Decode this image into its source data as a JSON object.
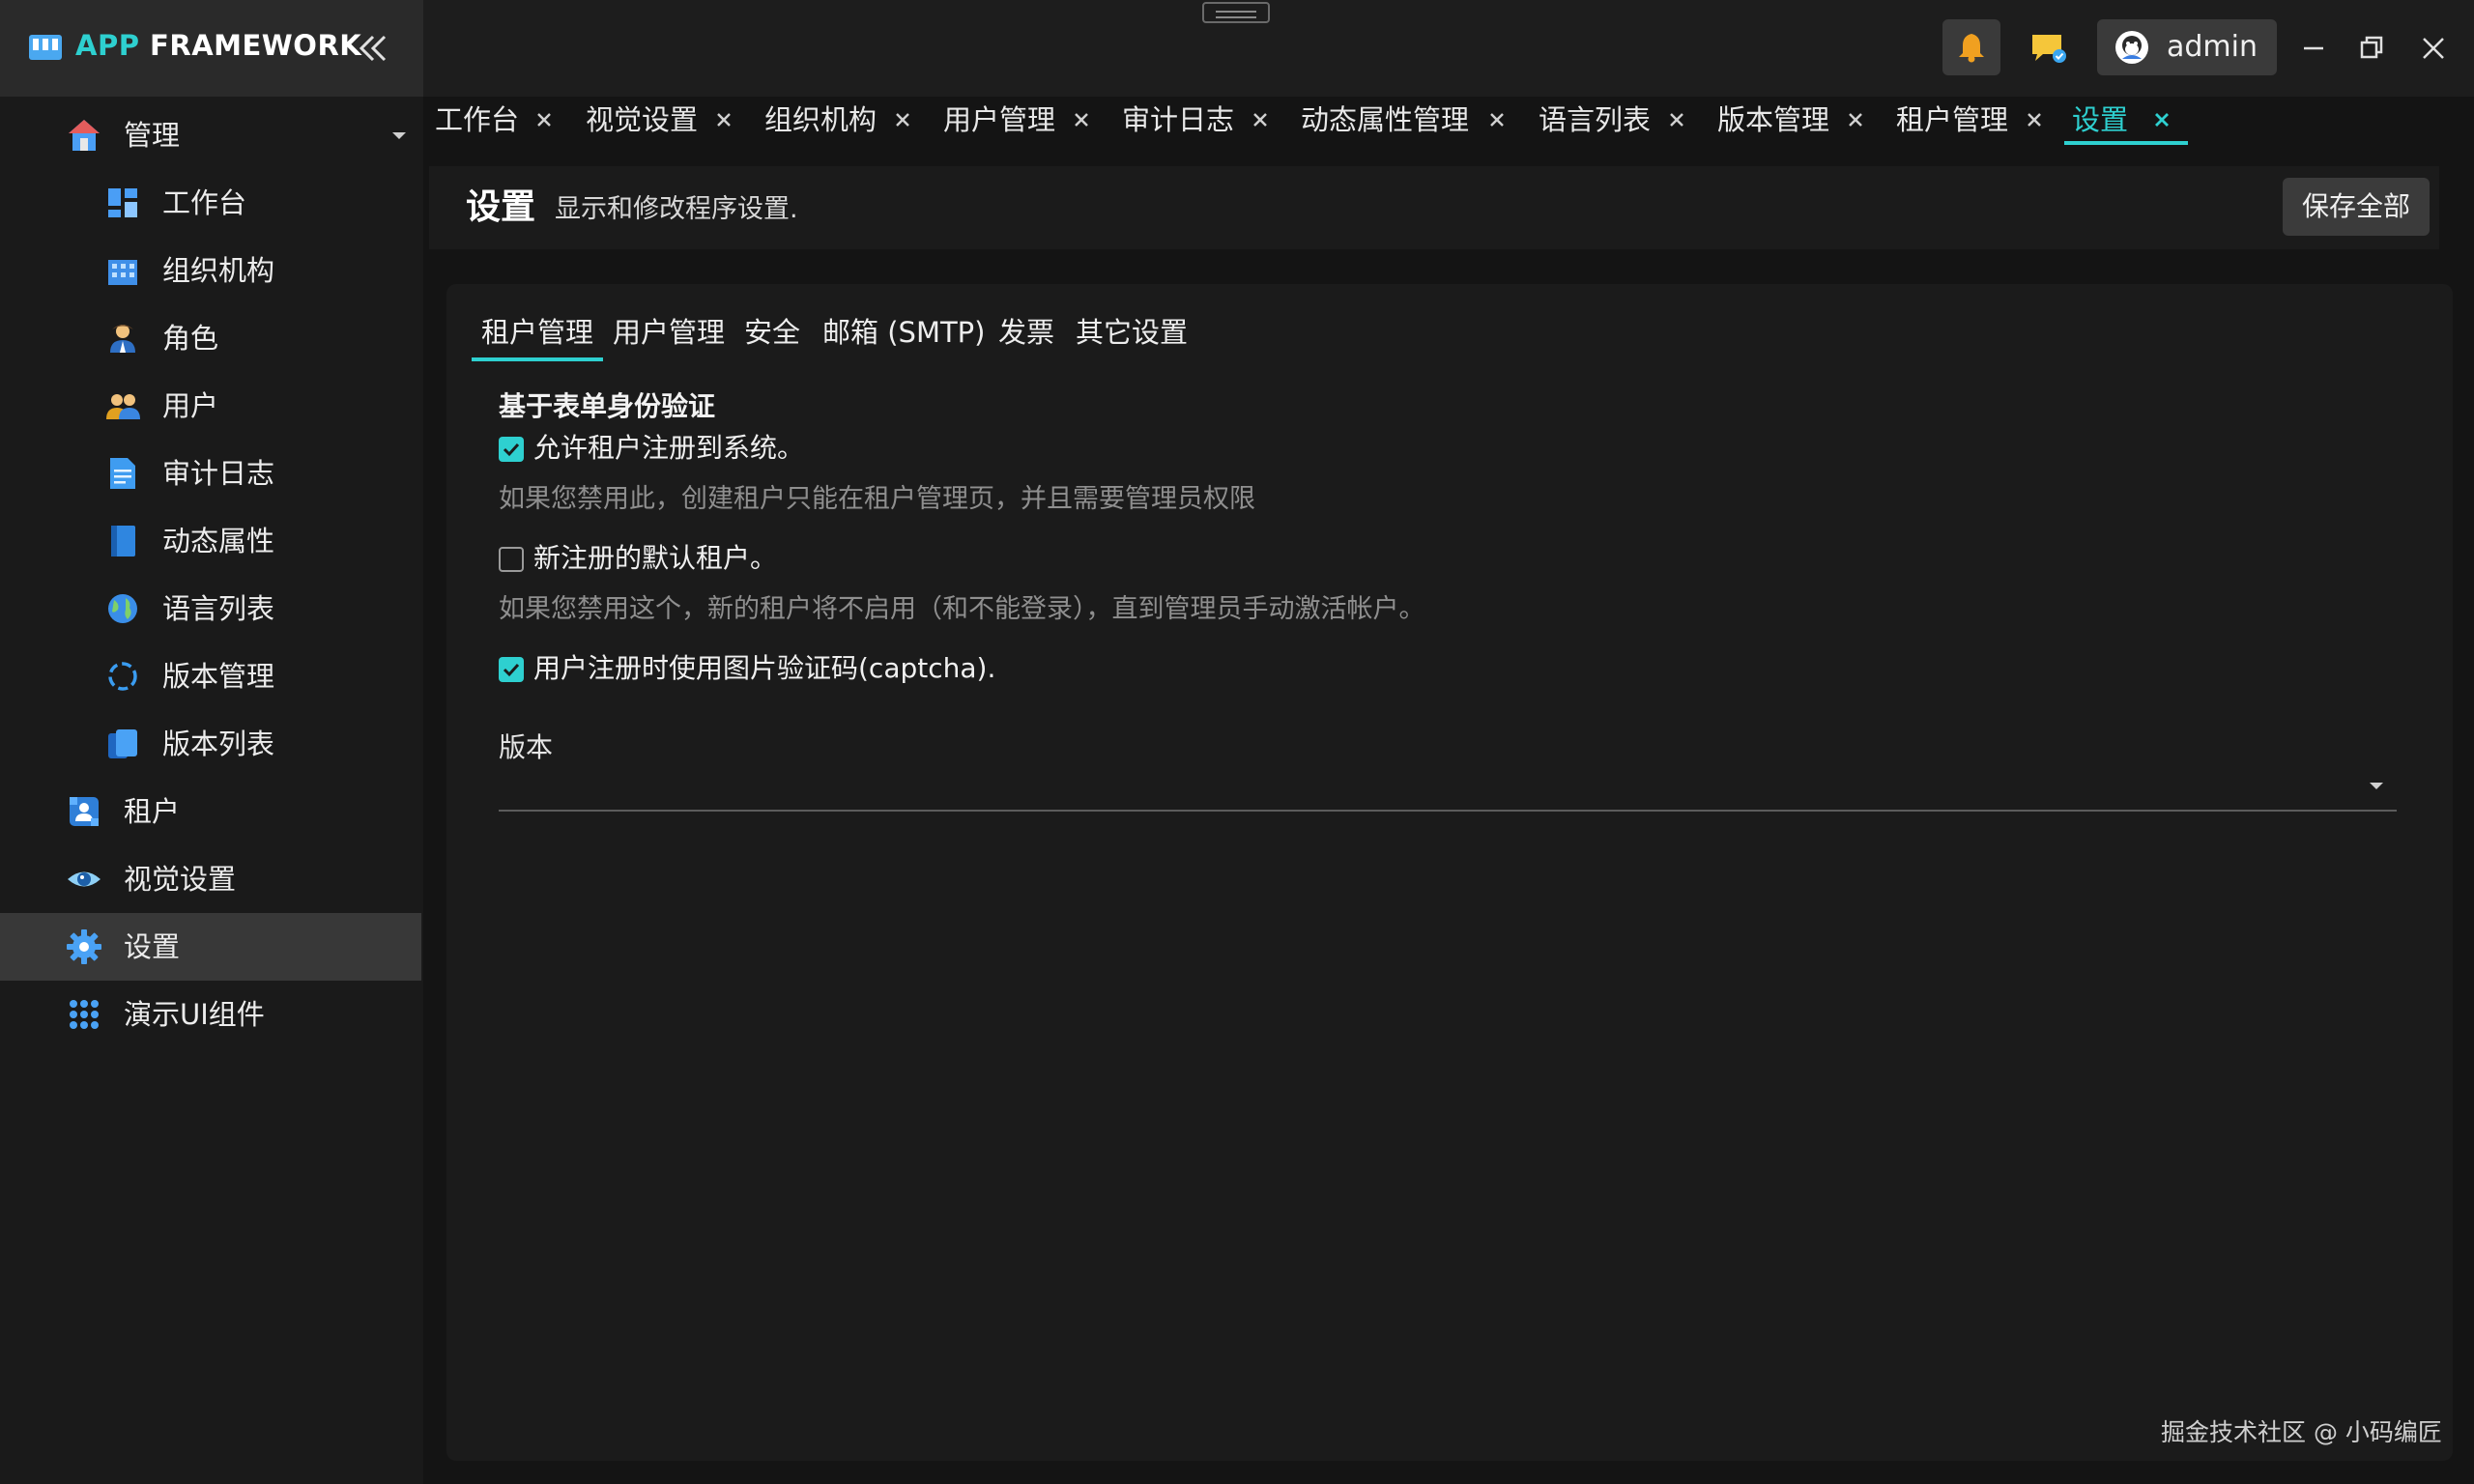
{
  "app": {
    "logo_accent": "APP",
    "logo_rest": " FRAMEWORK",
    "accent_color": "#2ed0d0"
  },
  "sidebar": {
    "items": [
      {
        "label": "管理",
        "icon": "home-icon"
      },
      {
        "label": "工作台",
        "icon": "dashboard-icon"
      },
      {
        "label": "组织机构",
        "icon": "building-icon"
      },
      {
        "label": "角色",
        "icon": "person-icon"
      },
      {
        "label": "用户",
        "icon": "users-icon"
      },
      {
        "label": "审计日志",
        "icon": "document-icon"
      },
      {
        "label": "动态属性",
        "icon": "book-icon"
      },
      {
        "label": "语言列表",
        "icon": "globe-icon"
      },
      {
        "label": "版本管理",
        "icon": "refresh-icon"
      },
      {
        "label": "版本列表",
        "icon": "copy-icon"
      },
      {
        "label": "租户",
        "icon": "tenant-icon"
      },
      {
        "label": "视觉设置",
        "icon": "eye-icon"
      },
      {
        "label": "设置",
        "icon": "gear-icon",
        "active": true
      },
      {
        "label": "演示UI组件",
        "icon": "grid-icon"
      }
    ]
  },
  "titlebar": {
    "user_name": "admin"
  },
  "tabs": [
    {
      "label": "工作台"
    },
    {
      "label": "视觉设置"
    },
    {
      "label": "组织机构"
    },
    {
      "label": "用户管理"
    },
    {
      "label": "审计日志"
    },
    {
      "label": "动态属性管理"
    },
    {
      "label": "语言列表"
    },
    {
      "label": "版本管理"
    },
    {
      "label": "租户管理"
    },
    {
      "label": "设置",
      "active": true
    }
  ],
  "header": {
    "title": "设置",
    "subtitle": "显示和修改程序设置.",
    "save_all": "保存全部"
  },
  "settings": {
    "sub_tabs": [
      "租户管理",
      "用户管理",
      "安全",
      "邮箱 (SMTP)",
      "发票",
      "其它设置"
    ],
    "active_sub_tab": "租户管理",
    "section_heading": "基于表单身份验证",
    "options": [
      {
        "label": "允许租户注册到系统。",
        "checked": true,
        "hint": "如果您禁用此，创建租户只能在租户管理页，并且需要管理员权限"
      },
      {
        "label": "新注册的默认租户。",
        "checked": false,
        "hint": "如果您禁用这个，新的租户将不启用（和不能登录），直到管理员手动激活帐户。"
      },
      {
        "label": "用户注册时使用图片验证码(captcha).",
        "checked": true,
        "hint": ""
      }
    ],
    "edition_label": "版本",
    "edition_value": ""
  },
  "watermark": "掘金技术社区 @ 小码编匠"
}
